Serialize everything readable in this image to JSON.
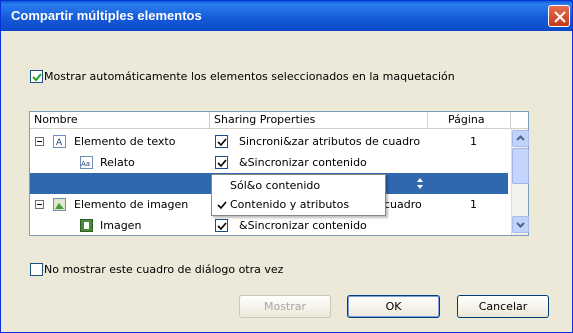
{
  "dialog": {
    "title": "Compartir múltiples elementos",
    "auto_show_label": "Mostrar automáticamente los elementos seleccionados en la maquetación",
    "auto_show_checked": true,
    "dont_show_label": "No mostrar este cuadro de diálogo otra vez",
    "dont_show_checked": false
  },
  "grid": {
    "headers": {
      "name": "Nombre",
      "sharing": "Sharing Properties",
      "page": "Página"
    },
    "rows": [
      {
        "name": "Elemento de texto",
        "icon": "text-frame-icon",
        "sharing": "Sincroni&zar atributos de cuadro",
        "page": "1",
        "checked": true
      },
      {
        "name": "Relato",
        "icon": "story-icon",
        "sharing": "&Sincronizar contenido",
        "page": "",
        "checked": true
      },
      {
        "name": "",
        "icon": "",
        "sharing": "",
        "page": "",
        "checked": false
      },
      {
        "name": "Elemento de imagen",
        "icon": "image-frame-icon",
        "sharing": "cuadro",
        "page": "1",
        "checked": false
      },
      {
        "name": "Imagen",
        "icon": "image-icon",
        "sharing": "&Sincronizar contenido",
        "page": "",
        "checked": true
      }
    ]
  },
  "popup": {
    "items": [
      {
        "label": "Sól&o contenido",
        "selected": false
      },
      {
        "label": "Contenido y atributos",
        "selected": true
      }
    ]
  },
  "buttons": {
    "show": "Mostrar",
    "ok": "OK",
    "cancel": "Cancelar"
  },
  "colors": {
    "titlebar": "#0a5bd6",
    "selection": "#3068b0",
    "dialog_bg": "#ece9d8"
  }
}
